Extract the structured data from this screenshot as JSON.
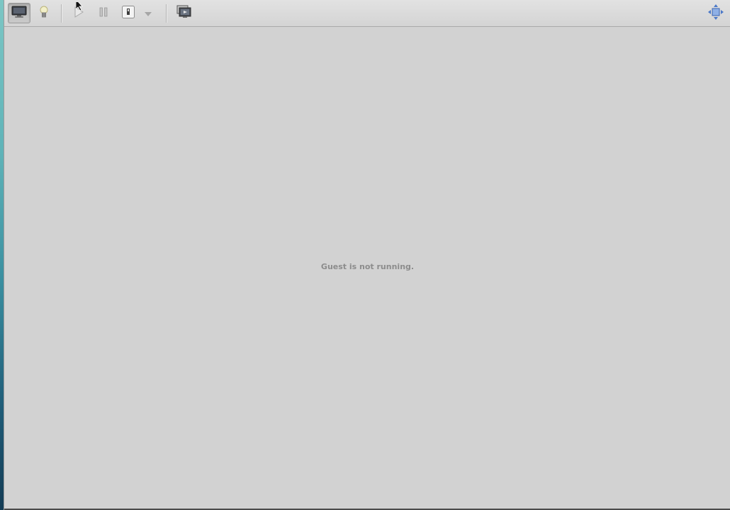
{
  "toolbar": {
    "buttons": [
      {
        "name": "console-view",
        "icon": "monitor-icon",
        "active": true
      },
      {
        "name": "details-view",
        "icon": "lightbulb-icon",
        "active": false
      },
      {
        "name": "run",
        "icon": "play-icon",
        "active": false
      },
      {
        "name": "pause",
        "icon": "pause-icon",
        "active": false
      },
      {
        "name": "shutdown",
        "icon": "power-icon",
        "active": false
      },
      {
        "name": "shutdown-menu",
        "icon": "chevron-down-icon",
        "active": false
      },
      {
        "name": "snapshots",
        "icon": "snapshots-icon",
        "active": false
      },
      {
        "name": "fullscreen",
        "icon": "fullscreen-icon",
        "active": false
      }
    ]
  },
  "main": {
    "status_message": "Guest is not running."
  },
  "colors": {
    "background": "#d2d2d2",
    "status_text": "#8c8c8c",
    "toolbar": "#dcdcdc"
  }
}
